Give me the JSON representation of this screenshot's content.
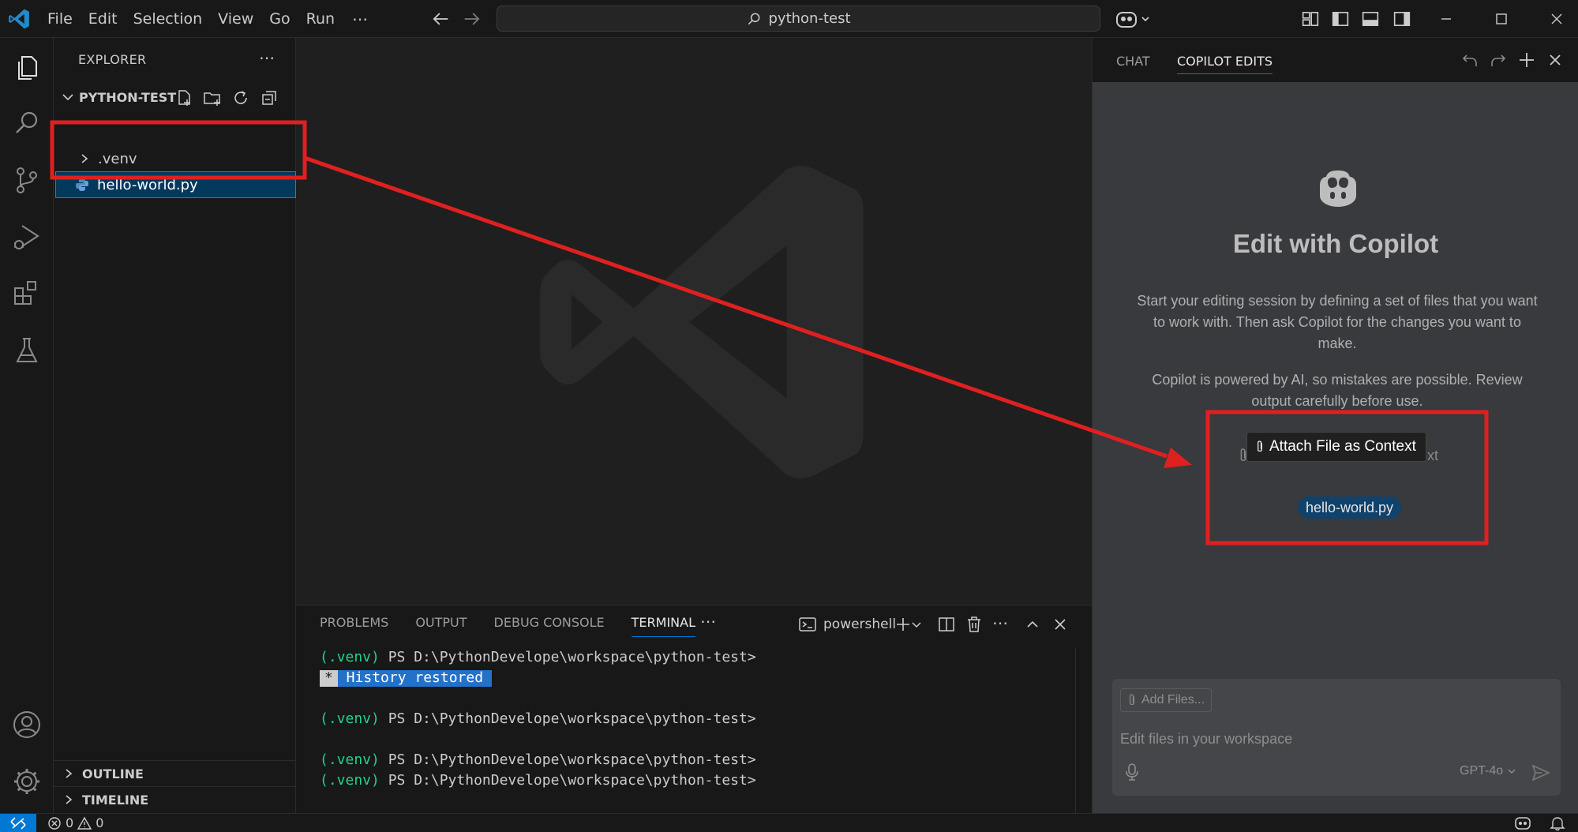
{
  "titlebar": {
    "menu": [
      "File",
      "Edit",
      "Selection",
      "View",
      "Go",
      "Run"
    ],
    "more": "⋯",
    "search_text": "python-test"
  },
  "explorer": {
    "title": "EXPLORER",
    "more": "⋯",
    "folder": "PYTHON-TEST",
    "items": [
      ".venv",
      "hello-world.py"
    ],
    "sections": [
      "OUTLINE",
      "TIMELINE"
    ]
  },
  "panel": {
    "tabs": [
      "PROBLEMS",
      "OUTPUT",
      "DEBUG CONSOLE",
      "TERMINAL"
    ],
    "active_tab": "TERMINAL",
    "more": "⋯",
    "terminal_name": "powershell",
    "terminal": {
      "prompt_venv": "(.venv)",
      "prompt_path": " PS D:\\PythonDevelope\\workspace\\python-test>",
      "history_star": "*",
      "history_text": " History restored "
    }
  },
  "copilot": {
    "tabs": [
      "CHAT",
      "COPILOT EDITS"
    ],
    "active_tab": "COPILOT EDITS",
    "title": "Edit with Copilot",
    "description": "Start your editing session by defining a set of files that you want to work with. Then ask Copilot for the changes you want to make.",
    "disclaimer": "Copilot is powered by AI, so mistakes are possible. Review output carefully before use.",
    "attach_tooltip": "Attach File as Context",
    "attach_hint_tail": "xt",
    "attached_file": "hello-world.py",
    "add_files": "Add Files...",
    "input_placeholder": "Edit files in your workspace",
    "model": "GPT-4o"
  },
  "statusbar": {
    "errors": "0",
    "warnings": "0"
  },
  "colors": {
    "accent": "#0078d4",
    "annotation": "#e02020",
    "terminal_green": "#23d18b"
  }
}
